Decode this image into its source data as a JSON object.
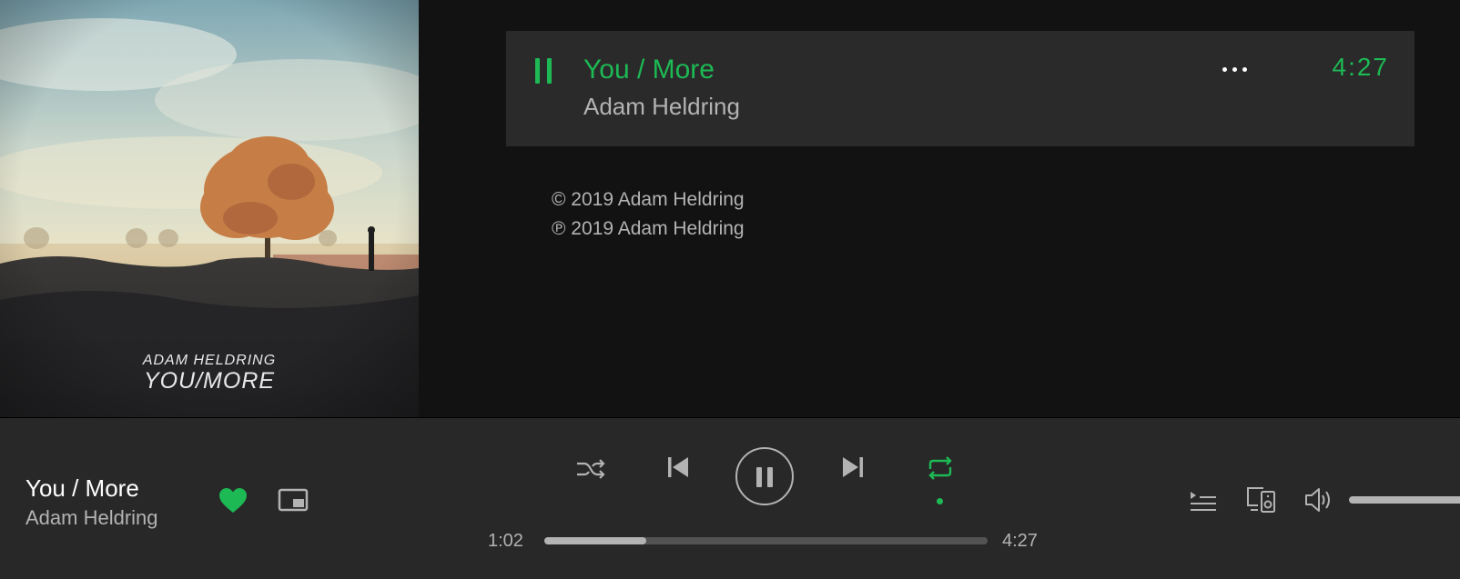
{
  "album": {
    "artist_text": "ADAM HELDRING",
    "title_text": "YOU/MORE"
  },
  "track_row": {
    "title": "You / More",
    "artist": "Adam Heldring",
    "duration": "4:27",
    "pause_icon": "pause-icon",
    "more_icon": "more-options-icon"
  },
  "copyright": {
    "c_line": "© 2019 Adam Heldring",
    "p_line": "℗ 2019 Adam Heldring"
  },
  "player": {
    "now_playing_title": "You / More",
    "now_playing_artist": "Adam Heldring",
    "liked": true,
    "elapsed": "1:02",
    "total": "4:27",
    "progress": 0.23,
    "volume": 1.0,
    "repeat_active": true
  },
  "colors": {
    "accent": "#1db954",
    "background": "#121212",
    "player_bar": "#282828",
    "row_highlight": "#2a2a2a",
    "text_secondary": "#b3b3b3"
  }
}
